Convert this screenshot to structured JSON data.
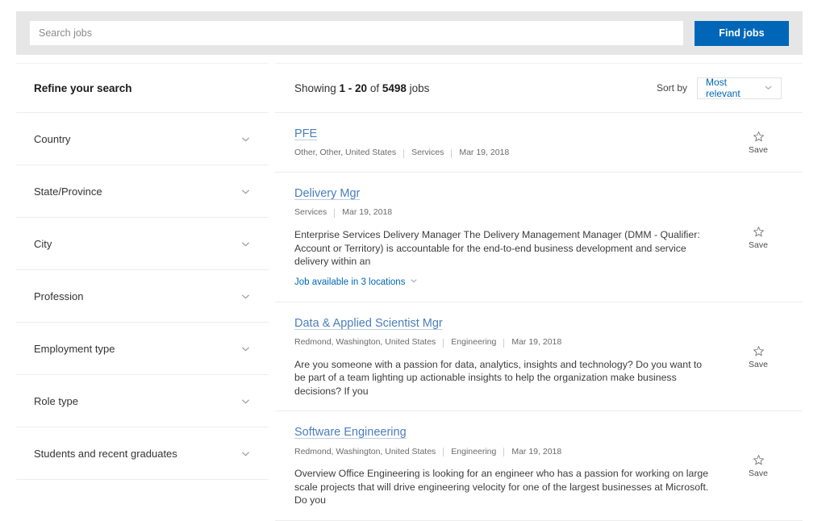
{
  "search": {
    "placeholder": "Search jobs",
    "value": "",
    "submit_label": "Find jobs",
    "button_color": "#0067b8"
  },
  "sidebar": {
    "header": "Refine your search",
    "items": [
      {
        "label": "Country",
        "icon": "chevron-down-icon"
      },
      {
        "label": "State/Province",
        "icon": "chevron-down-icon"
      },
      {
        "label": "City",
        "icon": "chevron-down-icon"
      },
      {
        "label": "Profession",
        "icon": "chevron-down-icon"
      },
      {
        "label": "Employment type",
        "icon": "chevron-down-icon"
      },
      {
        "label": "Role type",
        "icon": "chevron-down-icon"
      },
      {
        "label": "Students and recent graduates",
        "icon": "chevron-down-icon"
      }
    ]
  },
  "results_header": {
    "showing_prefix": "Showing ",
    "range": "1 - 20",
    "of_text": " of ",
    "total": "5498",
    "jobs_suffix": " jobs",
    "sort_by_label": "Sort by",
    "sort_value": "Most relevant",
    "sort_icon": "chevron-down-icon",
    "link_color": "#0067b8"
  },
  "jobs": [
    {
      "title": "PFE",
      "location": "Other, Other, United States",
      "category": "Services",
      "date": "Mar 19, 2018",
      "description": "",
      "locations_link": "",
      "save_label": "Save",
      "save_icon": "star-outline-icon"
    },
    {
      "title": "Delivery Mgr",
      "location": "",
      "category": "Services",
      "date": "Mar 19, 2018",
      "description": "Enterprise Services Delivery Manager The Delivery Management Manager (DMM - Qualifier: Account or Territory) is accountable for the end-to-end business development and service delivery within an",
      "locations_link": "Job available in 3 locations",
      "save_label": "Save",
      "save_icon": "star-outline-icon"
    },
    {
      "title": "Data & Applied Scientist Mgr",
      "location": "Redmond, Washington, United States",
      "category": "Engineering",
      "date": "Mar 19, 2018",
      "description": "Are you someone with a passion for data, analytics, insights and technology? Do you want to be part of a team lighting up actionable insights to help the organization make business decisions? If you",
      "locations_link": "",
      "save_label": "Save",
      "save_icon": "star-outline-icon"
    },
    {
      "title": "Software Engineering",
      "location": "Redmond, Washington, United States",
      "category": "Engineering",
      "date": "Mar 19, 2018",
      "description": "Overview Office Engineering is looking for an engineer who has a passion for working on large scale projects that will drive engineering velocity for one of the largest businesses at Microsoft. Do you",
      "locations_link": "",
      "save_label": "Save",
      "save_icon": "star-outline-icon"
    }
  ]
}
